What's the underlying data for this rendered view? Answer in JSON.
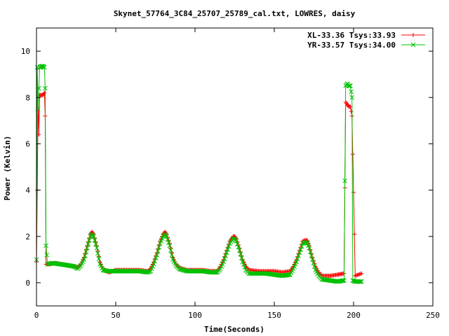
{
  "chart_data": {
    "type": "line",
    "title": "Skynet_57764_3C84_25707_25789_cal.txt, LOWRES, daisy",
    "xlabel": "Time(Seconds)",
    "ylabel": "Power (Kelvin)",
    "xlim": [
      0,
      250
    ],
    "ylim": [
      -1,
      11
    ],
    "xticks": [
      0,
      50,
      100,
      150,
      200,
      250
    ],
    "yticks": [
      0,
      2,
      4,
      6,
      8,
      10
    ],
    "grid": false,
    "legend_position": "top-right",
    "series": [
      {
        "name": "XL-33.36 Tsys:33.93",
        "color": "#ff0000",
        "marker": "plus",
        "points": [
          [
            0,
            0.9
          ],
          [
            0.5,
            4.0
          ],
          [
            1,
            8.0
          ],
          [
            1.5,
            6.4
          ],
          [
            2,
            8.1
          ],
          [
            3,
            8.1
          ],
          [
            4,
            8.1
          ],
          [
            5,
            8.2
          ],
          [
            5.5,
            7.2
          ],
          [
            6,
            0.8
          ],
          [
            8,
            0.8
          ],
          [
            12,
            0.85
          ],
          [
            16,
            0.8
          ],
          [
            20,
            0.75
          ],
          [
            24,
            0.7
          ],
          [
            26,
            0.65
          ],
          [
            28,
            0.8
          ],
          [
            30,
            1.1
          ],
          [
            32,
            1.6
          ],
          [
            34,
            2.1
          ],
          [
            35,
            2.2
          ],
          [
            36,
            2.1
          ],
          [
            38,
            1.6
          ],
          [
            40,
            0.9
          ],
          [
            42,
            0.6
          ],
          [
            44,
            0.5
          ],
          [
            46,
            0.45
          ],
          [
            50,
            0.55
          ],
          [
            55,
            0.55
          ],
          [
            60,
            0.55
          ],
          [
            65,
            0.55
          ],
          [
            70,
            0.5
          ],
          [
            72,
            0.6
          ],
          [
            74,
            0.9
          ],
          [
            76,
            1.3
          ],
          [
            78,
            1.8
          ],
          [
            80,
            2.1
          ],
          [
            81,
            2.2
          ],
          [
            82,
            2.1
          ],
          [
            84,
            1.7
          ],
          [
            86,
            1.1
          ],
          [
            88,
            0.8
          ],
          [
            90,
            0.65
          ],
          [
            95,
            0.55
          ],
          [
            100,
            0.55
          ],
          [
            105,
            0.55
          ],
          [
            110,
            0.5
          ],
          [
            114,
            0.5
          ],
          [
            116,
            0.7
          ],
          [
            118,
            1.0
          ],
          [
            120,
            1.4
          ],
          [
            122,
            1.8
          ],
          [
            124,
            2.0
          ],
          [
            125,
            2.0
          ],
          [
            126,
            1.9
          ],
          [
            128,
            1.5
          ],
          [
            130,
            1.0
          ],
          [
            132,
            0.7
          ],
          [
            134,
            0.55
          ],
          [
            140,
            0.5
          ],
          [
            145,
            0.5
          ],
          [
            150,
            0.5
          ],
          [
            155,
            0.45
          ],
          [
            160,
            0.5
          ],
          [
            162,
            0.7
          ],
          [
            164,
            1.0
          ],
          [
            166,
            1.4
          ],
          [
            168,
            1.8
          ],
          [
            170,
            1.85
          ],
          [
            171,
            1.8
          ],
          [
            172,
            1.6
          ],
          [
            174,
            1.1
          ],
          [
            176,
            0.7
          ],
          [
            178,
            0.45
          ],
          [
            180,
            0.3
          ],
          [
            185,
            0.3
          ],
          [
            190,
            0.35
          ],
          [
            194,
            0.4
          ],
          [
            195,
            7.8
          ],
          [
            196,
            7.7
          ],
          [
            197,
            7.6
          ],
          [
            198,
            7.6
          ],
          [
            199,
            7.2
          ],
          [
            200,
            3.9
          ],
          [
            201,
            0.3
          ],
          [
            203,
            0.35
          ],
          [
            205,
            0.4
          ]
        ]
      },
      {
        "name": "YR-33.57 Tsys:34.00",
        "color": "#00c000",
        "marker": "cross",
        "points": [
          [
            0,
            1.0
          ],
          [
            0.5,
            9.3
          ],
          [
            1,
            7.5
          ],
          [
            2,
            9.3
          ],
          [
            3,
            9.35
          ],
          [
            4,
            9.35
          ],
          [
            5,
            9.3
          ],
          [
            5.5,
            8.4
          ],
          [
            6,
            1.6
          ],
          [
            7,
            0.8
          ],
          [
            10,
            0.85
          ],
          [
            15,
            0.8
          ],
          [
            20,
            0.75
          ],
          [
            24,
            0.7
          ],
          [
            26,
            0.6
          ],
          [
            28,
            0.75
          ],
          [
            30,
            1.0
          ],
          [
            32,
            1.5
          ],
          [
            34,
            2.0
          ],
          [
            35,
            2.1
          ],
          [
            36,
            2.0
          ],
          [
            38,
            1.5
          ],
          [
            40,
            0.8
          ],
          [
            42,
            0.55
          ],
          [
            45,
            0.5
          ],
          [
            50,
            0.5
          ],
          [
            55,
            0.5
          ],
          [
            60,
            0.5
          ],
          [
            65,
            0.5
          ],
          [
            70,
            0.45
          ],
          [
            72,
            0.5
          ],
          [
            74,
            0.8
          ],
          [
            76,
            1.2
          ],
          [
            78,
            1.7
          ],
          [
            80,
            2.0
          ],
          [
            81,
            2.1
          ],
          [
            82,
            2.0
          ],
          [
            84,
            1.6
          ],
          [
            86,
            1.0
          ],
          [
            88,
            0.75
          ],
          [
            90,
            0.6
          ],
          [
            95,
            0.5
          ],
          [
            100,
            0.5
          ],
          [
            105,
            0.5
          ],
          [
            110,
            0.45
          ],
          [
            114,
            0.45
          ],
          [
            116,
            0.6
          ],
          [
            118,
            0.9
          ],
          [
            120,
            1.3
          ],
          [
            122,
            1.7
          ],
          [
            124,
            1.9
          ],
          [
            125,
            1.9
          ],
          [
            126,
            1.8
          ],
          [
            128,
            1.4
          ],
          [
            130,
            0.9
          ],
          [
            132,
            0.55
          ],
          [
            134,
            0.4
          ],
          [
            140,
            0.4
          ],
          [
            145,
            0.4
          ],
          [
            150,
            0.35
          ],
          [
            155,
            0.3
          ],
          [
            160,
            0.35
          ],
          [
            162,
            0.6
          ],
          [
            164,
            0.9
          ],
          [
            166,
            1.3
          ],
          [
            168,
            1.7
          ],
          [
            170,
            1.75
          ],
          [
            171,
            1.7
          ],
          [
            172,
            1.5
          ],
          [
            174,
            1.0
          ],
          [
            176,
            0.55
          ],
          [
            178,
            0.3
          ],
          [
            180,
            0.15
          ],
          [
            185,
            0.1
          ],
          [
            190,
            0.05
          ],
          [
            194,
            0.1
          ],
          [
            194.5,
            4.4
          ],
          [
            195,
            8.5
          ],
          [
            196,
            8.6
          ],
          [
            197,
            8.5
          ],
          [
            198,
            8.5
          ],
          [
            199,
            8.0
          ],
          [
            199.5,
            0.1
          ],
          [
            201,
            0.05
          ],
          [
            203,
            0.05
          ],
          [
            205,
            0.05
          ]
        ]
      }
    ]
  }
}
